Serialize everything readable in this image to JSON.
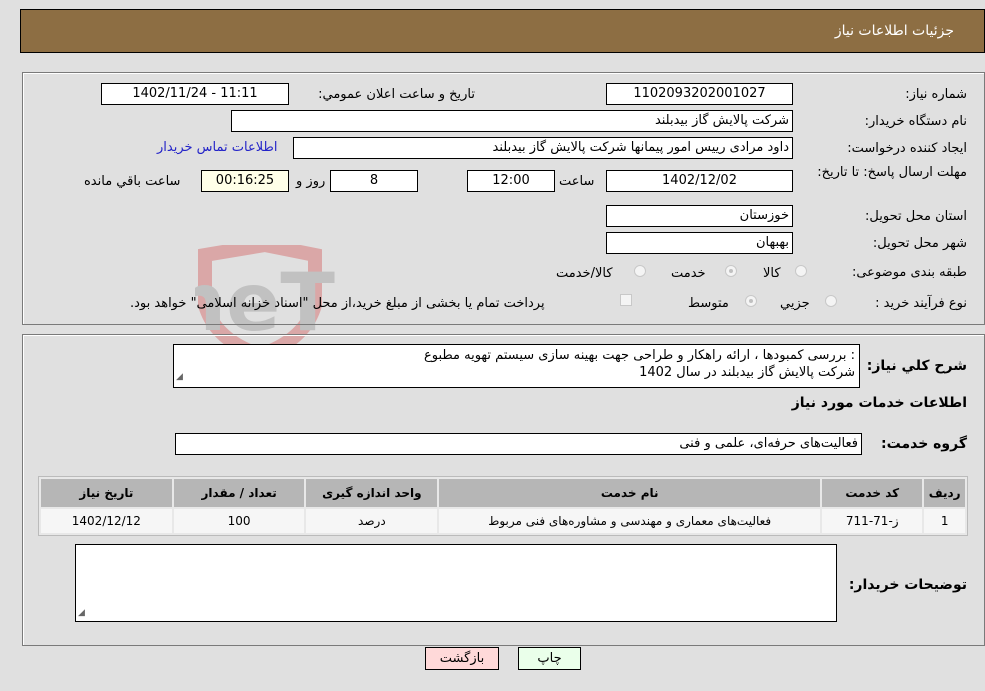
{
  "header": {
    "title": "جزئیات اطلاعات نیاز"
  },
  "details": {
    "need_number_label": "شماره نیاز:",
    "need_number": "1102093202001027",
    "announce_label": "تاریخ و ساعت اعلان عمومي:",
    "announce_value": "1402/11/24 - 11:11",
    "buyer_org_label": "نام دستگاه خریدار:",
    "buyer_org": "شرکت پالایش گاز بیدبلند",
    "creator_label": "ایجاد کننده درخواست:",
    "creator": "داود مرادی رییس امور پیمانها شرکت پالایش گاز بیدبلند",
    "contact_link": "اطلاعات تماس خریدار",
    "deadline_label": "مهلت ارسال پاسخ: تا تاریخ:",
    "deadline_date": "1402/12/02",
    "time_label": "ساعت",
    "deadline_time": "12:00",
    "days_value": "8",
    "days_label": "روز و",
    "remaining_time": "00:16:25",
    "remaining_label": "ساعت باقي مانده",
    "province_label": "استان محل تحویل:",
    "province": "خوزستان",
    "city_label": "شهر محل تحویل:",
    "city": "بهبهان",
    "category_label": "طبقه بندی موضوعی:",
    "category_options": [
      {
        "label": "کالا",
        "checked": false
      },
      {
        "label": "خدمت",
        "checked": true
      },
      {
        "label": "کالا/خدمت",
        "checked": false
      }
    ],
    "process_label": "نوع فرآیند خرید :",
    "process_options": [
      {
        "label": "جزيي",
        "checked": false
      },
      {
        "label": "متوسط",
        "checked": true
      }
    ],
    "treasury_note": "پرداخت تمام یا بخشی از مبلغ خرید،از محل \"اسناد خزانه اسلامی\" خواهد بود."
  },
  "summary": {
    "label": "شرح کلي نیاز:",
    "text_line1": ": بررسی کمبودها    ، ارائه راهکار و طراحی جهت بهینه سازی سیستم تهویه مطبوع",
    "text_line2": "شرکت پالایش گاز بیدبلند در سال 1402",
    "services_heading": "اطلاعات خدمات مورد نیاز",
    "service_group_label": "گروه خدمت:",
    "service_group": "فعالیت‌های حرفه‌ای، علمی و فنی"
  },
  "table": {
    "headers": [
      "ردیف",
      "کد خدمت",
      "نام خدمت",
      "واحد اندازه گیری",
      "تعداد / مقدار",
      "تاریخ نیاز"
    ],
    "rows": [
      [
        "1",
        "ز-71-711",
        "فعالیت‌های معماری و مهندسی و مشاوره‌های فنی مربوط",
        "درصد",
        "100",
        "1402/12/12"
      ]
    ]
  },
  "buyer_notes": {
    "label": "توضیحات خریدار:",
    "value": ""
  },
  "buttons": {
    "print": "چاپ",
    "back": "بازگشت"
  },
  "watermark": {
    "text": "AriaTender.neT"
  },
  "colors": {
    "header_bg": "#8d6e43",
    "page_bg": "#e0e0e0",
    "print_bg": "#eaffea",
    "back_bg": "#ffd9d9",
    "link": "#2424c8"
  }
}
